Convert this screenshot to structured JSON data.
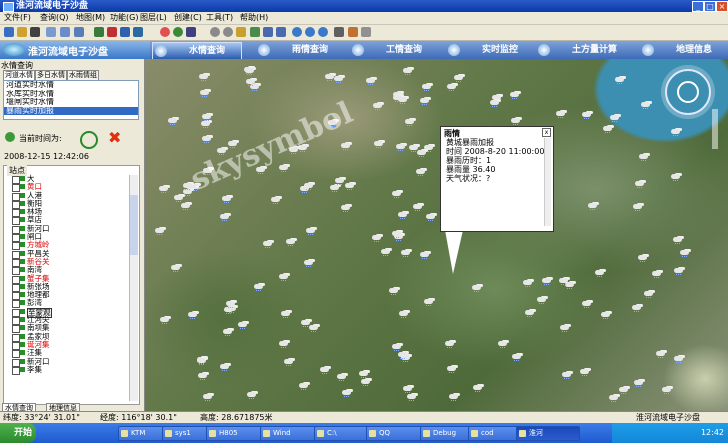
{
  "window": {
    "title": "淮河流域电子沙盘"
  },
  "menu": [
    "文件(F)",
    "查询(Q)",
    "地图(M)",
    "功能(G)",
    "图层(L)",
    "创建(C)",
    "工具(T)",
    "帮助(H)"
  ],
  "app": {
    "logo_text": "淮河流域电子沙盘"
  },
  "modules": [
    {
      "label": "水情查询",
      "active": true
    },
    {
      "label": "雨情查询",
      "active": false
    },
    {
      "label": "工情查询",
      "active": false
    },
    {
      "label": "实时监控",
      "active": false
    },
    {
      "label": "土方量计算",
      "active": false
    },
    {
      "label": "地理信息",
      "active": false
    }
  ],
  "left": {
    "panel_title": "水情查询",
    "tabs": [
      "河道水情",
      "多日水情",
      "水雨情组"
    ],
    "water_list": [
      "河道实时水情",
      "水库实时水情",
      "堰闸实时水情",
      "暴雨实时加报"
    ],
    "current_time_label": "当前时间为:",
    "current_time": "2008-12-15 12:42:06",
    "stations_legend": "站点",
    "stations": [
      {
        "name": "大",
        "color": "black"
      },
      {
        "name": "黄口",
        "color": "red"
      },
      {
        "name": "人港",
        "color": "black"
      },
      {
        "name": "衡阳",
        "color": "black"
      },
      {
        "name": "林场",
        "color": "black"
      },
      {
        "name": "草店",
        "color": "black"
      },
      {
        "name": "新河口",
        "color": "black"
      },
      {
        "name": "闸口",
        "color": "black"
      },
      {
        "name": "方城岭",
        "color": "red"
      },
      {
        "name": "平昌关",
        "color": "black"
      },
      {
        "name": "新谷关",
        "color": "red"
      },
      {
        "name": "南湾",
        "color": "black"
      },
      {
        "name": "蟹子集",
        "color": "red"
      },
      {
        "name": "新张场",
        "color": "black"
      },
      {
        "name": "地理都",
        "color": "black"
      },
      {
        "name": "彭湾",
        "color": "black"
      },
      {
        "name": "至蒙观",
        "color": "black",
        "boxed": true
      },
      {
        "name": "江河尖",
        "color": "black"
      },
      {
        "name": "南坝集",
        "color": "black"
      },
      {
        "name": "孟家坝",
        "color": "black"
      },
      {
        "name": "诞河集",
        "color": "red"
      },
      {
        "name": "汪集",
        "color": "black"
      },
      {
        "name": "新河口",
        "color": "black"
      },
      {
        "name": "李集",
        "color": "black"
      }
    ],
    "bottom_tabs": [
      "水情查询",
      "地理信息"
    ]
  },
  "popup": {
    "title": "雨情",
    "lines": [
      "黄城暴雨加报",
      "时间 2008-8-20 11:00:00",
      "暴雨历时：1",
      "暴雨量 36.40",
      "天气状况：?"
    ]
  },
  "watermark": "skysymbol",
  "status": {
    "lat": "纬度: 33°24' 31.01\"",
    "lon": "经度: 116°18' 30.1\"",
    "height": "高度: 28.671875米",
    "title": "淮河流域电子沙盘"
  },
  "taskbar": {
    "start": "开始",
    "items": [
      "KTM",
      "sys1",
      "H805",
      "Wind",
      "C:\\",
      "QQ",
      "Debug",
      "cod",
      "淮河"
    ],
    "clock": "12:42"
  }
}
